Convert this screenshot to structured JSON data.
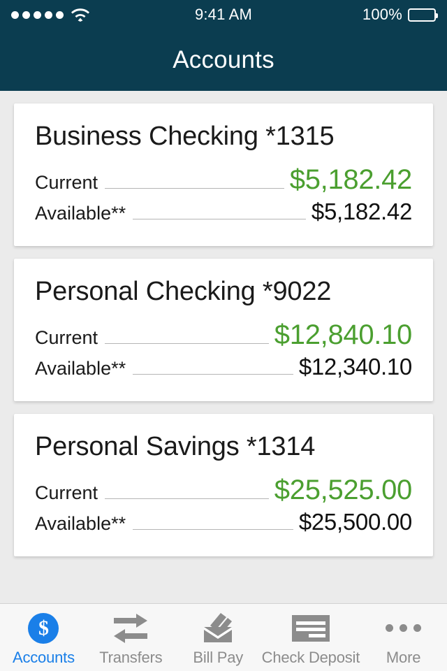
{
  "status_bar": {
    "signal_dots": 5,
    "wifi_icon": "wifi-icon",
    "time": "9:41 AM",
    "battery_percent": "100%",
    "battery_icon": "battery-full-icon"
  },
  "nav_bar": {
    "title": "Accounts"
  },
  "theme": {
    "nav_background": "#0b3d50",
    "page_background": "#ebebeb",
    "card_background": "#ffffff",
    "positive_amount": "#4b9f30",
    "amount": "#111111",
    "accent": "#1a7fe8",
    "tab_inactive": "#8c8c8c"
  },
  "accounts": [
    {
      "title": "Business Checking *1315",
      "current_label": "Current",
      "current_value": "$5,182.42",
      "available_label": "Available**",
      "available_value": "$5,182.42"
    },
    {
      "title": "Personal Checking *9022",
      "current_label": "Current",
      "current_value": "$12,840.10",
      "available_label": "Available**",
      "available_value": "$12,340.10"
    },
    {
      "title": "Personal Savings *1314",
      "current_label": "Current",
      "current_value": "$25,525.00",
      "available_label": "Available**",
      "available_value": "$25,500.00"
    }
  ],
  "tab_bar": {
    "items": [
      {
        "label": "Accounts",
        "icon": "dollar-circle-icon",
        "active": true
      },
      {
        "label": "Transfers",
        "icon": "transfer-arrows-icon",
        "active": false
      },
      {
        "label": "Bill Pay",
        "icon": "envelope-pen-icon",
        "active": false
      },
      {
        "label": "Check Deposit",
        "icon": "check-lines-icon",
        "active": false
      },
      {
        "label": "More",
        "icon": "ellipsis-icon",
        "active": false
      }
    ]
  }
}
